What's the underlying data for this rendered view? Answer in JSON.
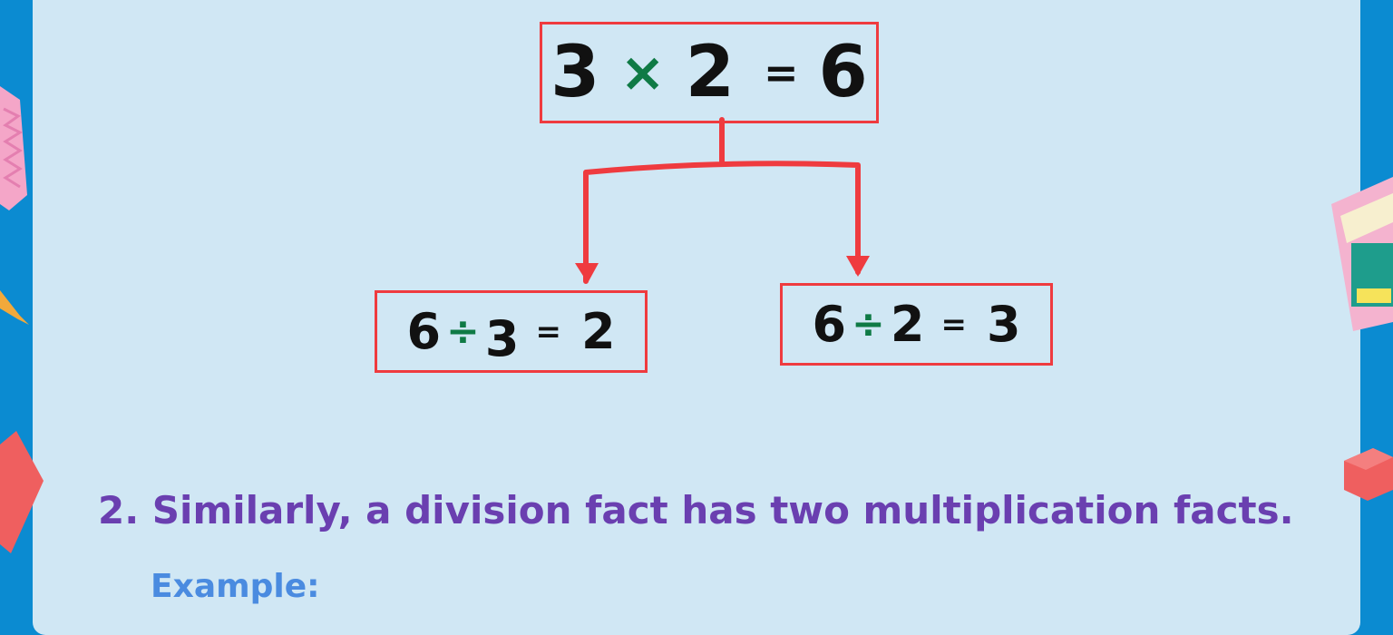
{
  "top_equation": {
    "a": "3",
    "op": "×",
    "b": "2",
    "eq": "=",
    "result": "6"
  },
  "left_equation": {
    "a": "6",
    "op": "÷",
    "b": "3",
    "eq": "=",
    "result": "2"
  },
  "right_equation": {
    "a": "6",
    "op": "÷",
    "b": "2",
    "eq": "=",
    "result": "3"
  },
  "heading": "2. Similarly, a division fact has two multiplication facts.",
  "example_label": "Example:",
  "colors": {
    "background": "#0b8bd1",
    "panel": "#d0e7f4",
    "box_border": "#ef3b3f",
    "operator": "#0f7a45",
    "heading": "#6a3fb0",
    "example": "#4a8be0"
  }
}
